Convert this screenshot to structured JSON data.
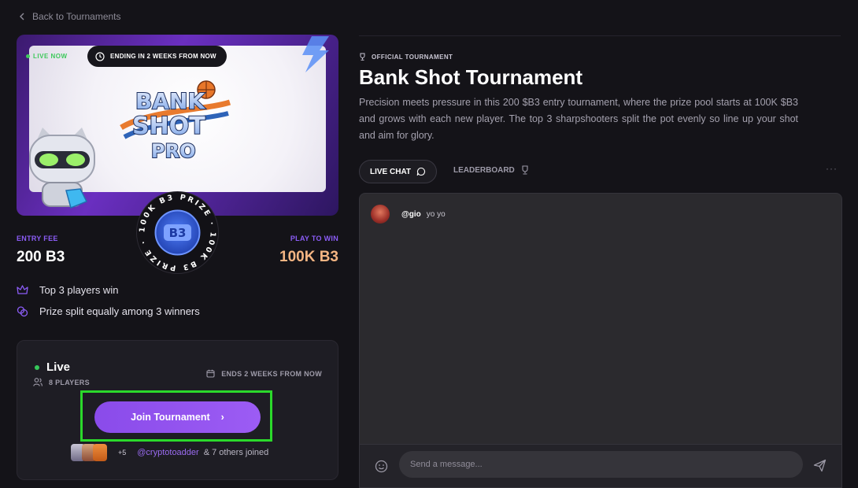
{
  "nav": {
    "back_label": "Back to Tournaments"
  },
  "banner": {
    "live_label": "LIVE NOW",
    "ending_label": "ENDING IN 2 WEEKS FROM NOW",
    "logo_lines": [
      "BANK",
      "SHOT",
      "PRO"
    ]
  },
  "seal": {
    "ring_text": "100K B3 PRIZE · 100K B3 PRIZE ·",
    "center": "B3"
  },
  "entry": {
    "label": "ENTRY FEE",
    "value": "200 B3"
  },
  "prize": {
    "label": "PLAY TO WIN",
    "value": "100K B3"
  },
  "features": [
    {
      "icon": "crown-icon",
      "text": "Top 3 players win"
    },
    {
      "icon": "coins-icon",
      "text": "Prize split equally among 3 winners"
    }
  ],
  "status_card": {
    "status": "Live",
    "players": "8 PLAYERS",
    "ends": "ENDS 2 WEEKS FROM NOW",
    "join_label": "Join Tournament",
    "join_chevron": "›",
    "extra_count": "+5",
    "joined_handle": "@cryptotoadder",
    "joined_suffix": "& 7 others joined"
  },
  "tournament": {
    "badge": "OFFICIAL TOURNAMENT",
    "title": "Bank Shot Tournament",
    "description": "Precision meets pressure in this 200 $B3 entry tournament, where the prize pool starts at 100K $B3 and grows with each new player. The top 3 sharpshooters split the pot evenly so line up your shot and aim for glory."
  },
  "tabs": {
    "chat": "LIVE CHAT",
    "leaderboard": "LEADERBOARD",
    "more": "···"
  },
  "chat": {
    "messages": [
      {
        "user": "@gio",
        "text": "yo yo"
      }
    ],
    "placeholder": "Send a message..."
  },
  "colors": {
    "accent": "#8b5cf6",
    "prize": "#f4b583",
    "live": "#36c85a",
    "highlight": "#2bd92b"
  }
}
